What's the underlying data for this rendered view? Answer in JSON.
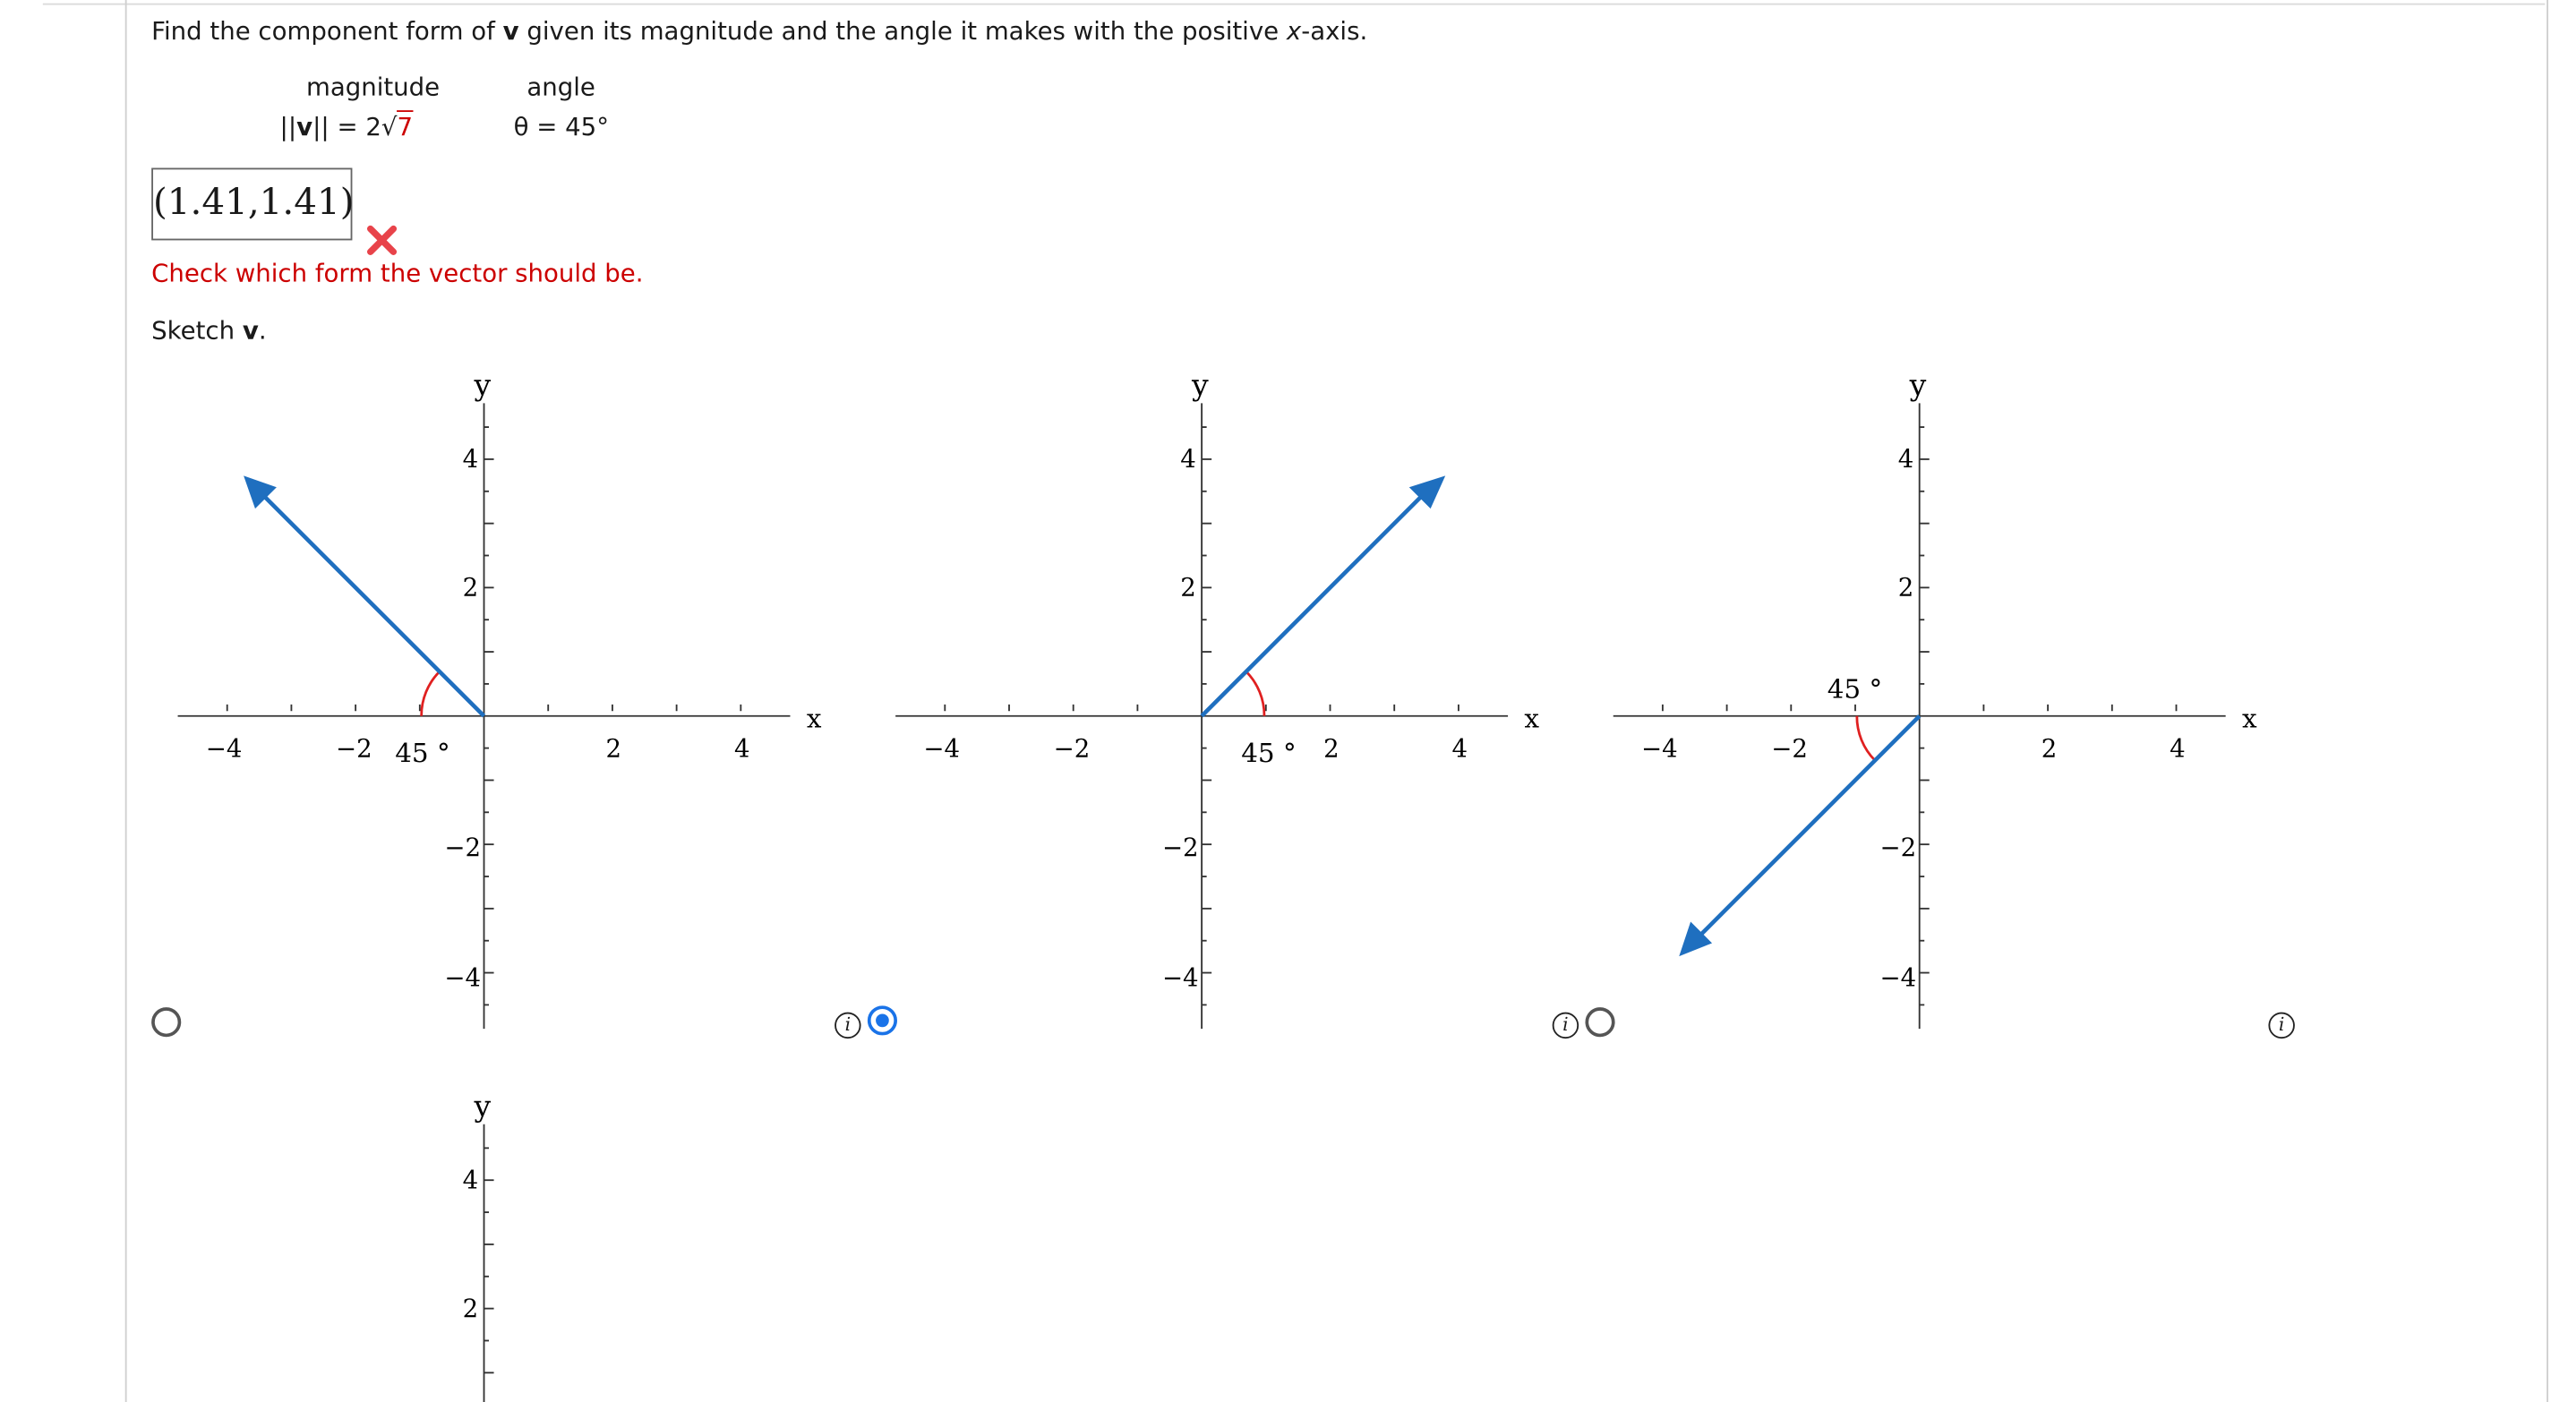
{
  "question": {
    "prefix": "Find the component form of ",
    "vec": "v",
    "middle": " given its magnitude and the angle it makes with the positive ",
    "axis": "x",
    "suffix": "-axis."
  },
  "given": {
    "magnitude_header": "magnitude",
    "angle_header": "angle",
    "magnitude_lhs": "||",
    "magnitude_vec": "v",
    "magnitude_rhs": "|| = 2",
    "magnitude_radicand": "7",
    "angle_value": "θ = 45°"
  },
  "answer": {
    "value": "(1.41,1.41)",
    "feedback": "Check which form the vector should be."
  },
  "sketch": {
    "prefix": "Sketch ",
    "vec": "v",
    "suffix": "."
  },
  "graph_labels": {
    "x": "x",
    "y": "y",
    "ticks_x": [
      "−4",
      "−2",
      "2",
      "4"
    ],
    "ticks_y": [
      "4",
      "2",
      "−2",
      "−4"
    ],
    "angle": "45 °"
  },
  "options": [
    {
      "id": "a",
      "selected": false,
      "vector_tip": [
        -3.7,
        3.7
      ],
      "angle_side": "left"
    },
    {
      "id": "b",
      "selected": true,
      "vector_tip": [
        3.7,
        3.7
      ],
      "angle_side": "right"
    },
    {
      "id": "c",
      "selected": false,
      "vector_tip": [
        -3.7,
        -3.7
      ],
      "angle_side": "below"
    }
  ],
  "colors": {
    "vector": "#1f6fbf",
    "arc": "#e02020",
    "feedback": "#cc0000",
    "selected": "#1a73e8"
  }
}
